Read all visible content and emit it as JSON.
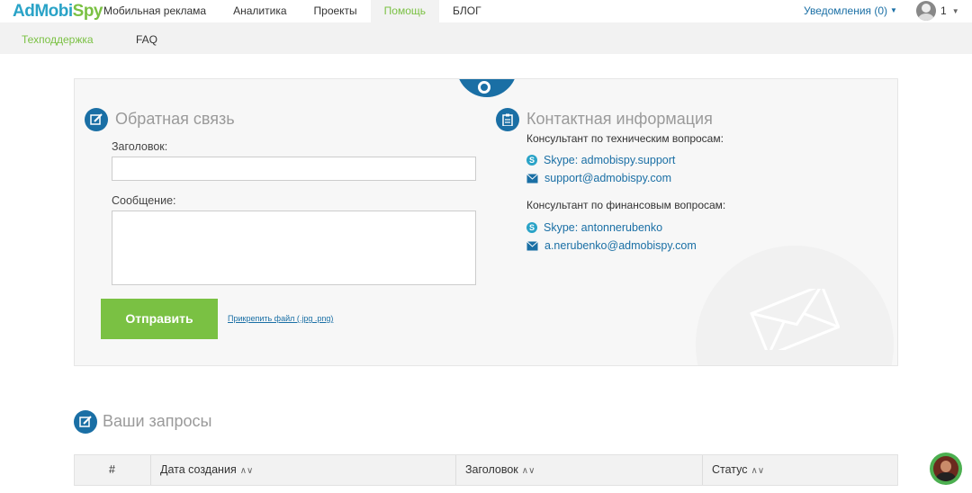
{
  "brand": {
    "ad": "AdMobi",
    "spy": "Spy"
  },
  "nav": {
    "items": [
      {
        "label": "Мобильная реклама"
      },
      {
        "label": "Аналитика"
      },
      {
        "label": "Проекты"
      },
      {
        "label": "Помощь"
      },
      {
        "label": "БЛОГ"
      }
    ],
    "active_index": 3
  },
  "notifications": {
    "label": "Уведомления (0)"
  },
  "user": {
    "count": "1"
  },
  "subnav": {
    "support": "Техподдержка",
    "faq": "FAQ"
  },
  "feedback": {
    "title": "Обратная связь",
    "subject_label": "Заголовок:",
    "subject_value": "",
    "message_label": "Сообщение:",
    "message_value": "",
    "send_button": "Отправить",
    "attach_link": "Прикрепить файл (.jpg .png)"
  },
  "contacts": {
    "title": "Контактная информация",
    "tech": {
      "heading": "Консультант по техническим вопросам:",
      "skype": "Skype: admobispy.support",
      "email": "support@admobispy.com"
    },
    "finance": {
      "heading": "Консультант по финансовым вопросам:",
      "skype": "Skype: antonnerubenko",
      "email": "a.nerubenko@admobispy.com"
    }
  },
  "requests": {
    "title": "Ваши запросы",
    "columns": [
      "#",
      "Дата создания",
      "Заголовок",
      "Статус"
    ]
  },
  "colors": {
    "accent_blue": "#1a6fa5",
    "accent_green": "#7ac143"
  }
}
